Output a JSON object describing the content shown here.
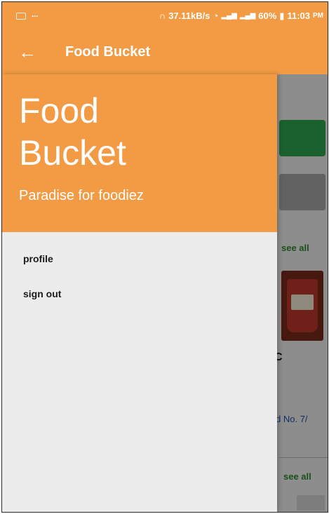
{
  "status_bar": {
    "speed": "37.11kB/s",
    "battery": "60%",
    "time": "11:03",
    "time_suffix": "PM"
  },
  "app_bar": {
    "title": "Food Bucket",
    "back_icon": "arrow-left-icon"
  },
  "drawer": {
    "title": "Food Bucket",
    "subtitle": "Paradise for foodiez",
    "items": [
      {
        "label": "profile"
      },
      {
        "label": "sign out"
      }
    ]
  },
  "background": {
    "see_all_1": "see all",
    "restaurant_initial": "C",
    "address_fragment": "d No. 7/",
    "see_all_2": "see all"
  },
  "colors": {
    "accent": "#f39b44",
    "drawer_bg": "#ececec",
    "green_button": "#2fa84f",
    "link_blue": "#1f4fa8",
    "see_all_green": "#2e8b2e"
  }
}
